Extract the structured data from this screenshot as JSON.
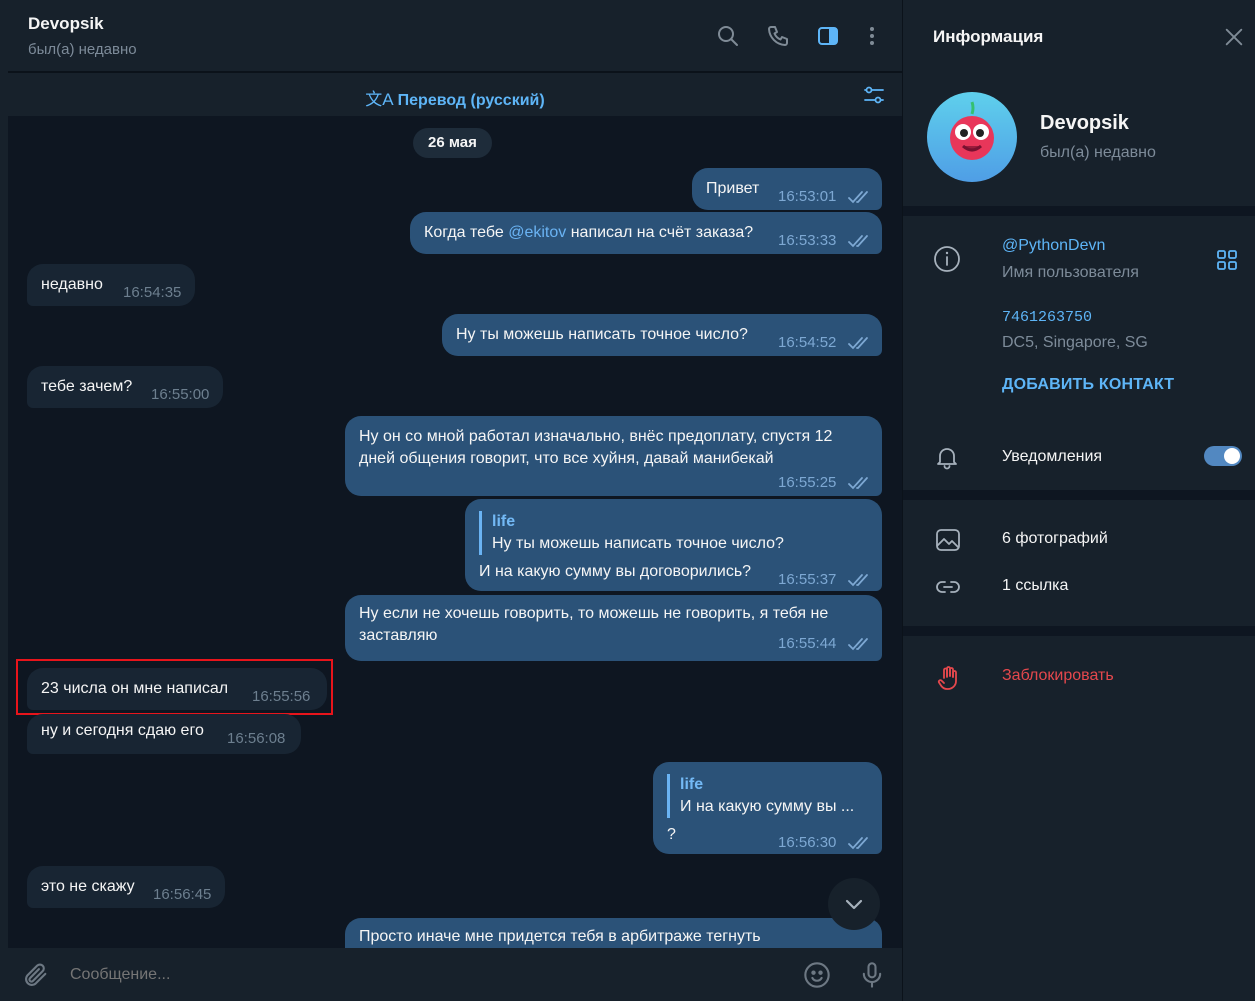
{
  "chat": {
    "title": "Devopsik",
    "status": "был(а) недавно",
    "translate_label": "Перевод (русский)",
    "translate_icon": "translate-icon",
    "date": "26 мая",
    "composer_placeholder": "Сообщение..."
  },
  "messages": [
    {
      "dir": "out",
      "text": "Привет",
      "time": "16:53:01"
    },
    {
      "dir": "out",
      "text_before": "Когда тебе ",
      "mention": "@ekitov",
      "text_after": " написал на счёт заказа?",
      "time": "16:53:33"
    },
    {
      "dir": "in",
      "text": "недавно",
      "time": "16:54:35"
    },
    {
      "dir": "out",
      "text": "Ну ты можешь написать точное число?",
      "time": "16:54:52"
    },
    {
      "dir": "in",
      "text": "тебе зачем?",
      "time": "16:55:00"
    },
    {
      "dir": "out",
      "line1": "Ну он со мной работал изначально, внёс предоплату, спустя 12",
      "line2": "дней общения говорит, что все хуйня, давай манибекай",
      "time": "16:55:25"
    },
    {
      "dir": "out",
      "reply_name": "life",
      "reply_text": "Ну ты можешь написать точное число?",
      "text": "И на какую сумму вы договорились?",
      "time": "16:55:37"
    },
    {
      "dir": "out",
      "line1": "Ну если не хочешь говорить, то можешь не говорить, я тебя не",
      "line2": "заставляю",
      "time": "16:55:44"
    },
    {
      "dir": "in",
      "text": "23 числа он мне написал",
      "time": "16:55:56"
    },
    {
      "dir": "in",
      "text": "ну и сегодня сдаю его",
      "time": "16:56:08"
    },
    {
      "dir": "out",
      "reply_name": "life",
      "reply_text": "И на какую сумму вы ...",
      "text": "?",
      "time": "16:56:30"
    },
    {
      "dir": "in",
      "text": "это не скажу",
      "time": "16:56:45"
    },
    {
      "dir": "out",
      "text": "Просто иначе мне придется тебя в арбитраже тегнуть"
    }
  ],
  "info": {
    "title": "Информация",
    "name": "Devopsik",
    "status": "был(а) недавно",
    "username": "@PythonDevn",
    "username_label": "Имя пользователя",
    "user_id": "7461263750",
    "dc": "DC5, Singapore, SG",
    "add_contact": "ДОБАВИТЬ КОНТАКТ",
    "notifications": "Уведомления",
    "notifications_on": true,
    "photos": "6 фотографий",
    "links": "1 ссылка",
    "block": "Заблокировать"
  },
  "colors": {
    "accent": "#5eb5f7",
    "outgoing_bubble": "#2b5278",
    "incoming_bubble": "#182533",
    "danger": "#e5484d",
    "highlight": "#e8141b"
  }
}
